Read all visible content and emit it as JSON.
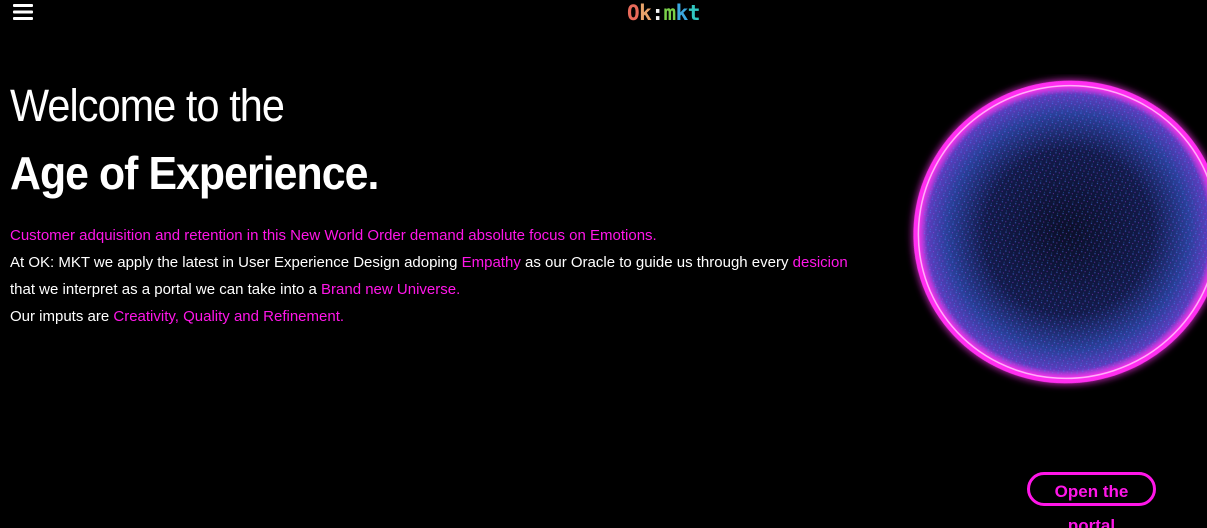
{
  "header": {
    "menu_icon": "hamburger-menu-icon",
    "logo": {
      "parts": [
        {
          "text": "O",
          "color": "#e86a5a"
        },
        {
          "text": "k",
          "color": "#e8a36a"
        },
        {
          "text": ":",
          "color": "#f5f5f5"
        },
        {
          "text": "m",
          "color": "#7ad14a"
        },
        {
          "text": "k",
          "color": "#3ba7e0"
        },
        {
          "text": "t",
          "color": "#31c7c0"
        }
      ]
    }
  },
  "hero": {
    "headline_light": "Welcome to the",
    "headline_bold": "Age of Experience.",
    "paragraph": {
      "line1": "Customer adquisition and retention in this New World Order demand absolute focus on Emotions.",
      "line2_a": "At OK: MKT we apply the latest in User Experience Design adoping ",
      "line2_b": "Empathy",
      "line2_c": " as our Oracle to guide us through every ",
      "line2_d": "desicion",
      "line3_a": "that we interpret as a portal we can take into a ",
      "line3_b": "Brand new Universe.",
      "line4_a": "Our imputs are ",
      "line4_b": "Creativity, Quality and Refinement."
    }
  },
  "cta": {
    "portal_button": "Open the portal"
  },
  "colors": {
    "background": "#000000",
    "accent": "#ff16e8",
    "text": "#ffffff"
  }
}
